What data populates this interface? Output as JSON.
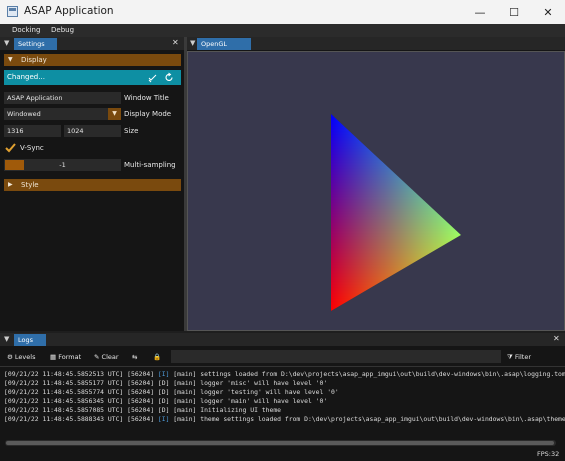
{
  "window": {
    "title": "ASAP Application",
    "minimize_glyph": "—",
    "maximize_glyph": "☐",
    "close_glyph": "✕"
  },
  "menu": {
    "items": [
      "Docking",
      "Debug"
    ]
  },
  "settings": {
    "tab_label": "Settings",
    "close_glyph": "✕",
    "display_header": "Display",
    "changed_label": "Changed...",
    "window_title_value": "ASAP Application",
    "window_title_label": "Window Title",
    "display_mode_value": "Windowed",
    "display_mode_label": "Display Mode",
    "width_value": "1316",
    "height_value": "1024",
    "size_label": "Size",
    "vsync_label": "V-Sync",
    "vsync_checked": true,
    "multisampling_value": "-1",
    "multisampling_label": "Multi-sampling",
    "style_header": "Style"
  },
  "render": {
    "tab_label": "OpenGL Render"
  },
  "logs": {
    "tab_label": "Logs",
    "close_glyph": "✕",
    "toolbar": {
      "levels": "Levels",
      "format": "Format",
      "clear": "Clear",
      "filter": "Filter"
    },
    "lines": [
      {
        "prefix": "[09/21/22 11:48:45.5852513 UTC] [56204] ",
        "level": "[I]",
        "msg": " [main] settings loaded from D:\\dev\\projects\\asap_app_imgui\\out\\build\\dev-windows\\bin\\.asap\\logging.toml"
      },
      {
        "prefix": "[09/21/22 11:48:45.5855177 UTC] [56204] ",
        "level": "[D]",
        "msg": " [main] logger 'misc' will have level '0'"
      },
      {
        "prefix": "[09/21/22 11:48:45.5855774 UTC] [56204] ",
        "level": "[D]",
        "msg": " [main] logger 'testing' will have level '0'"
      },
      {
        "prefix": "[09/21/22 11:48:45.5856345 UTC] [56204] ",
        "level": "[D]",
        "msg": " [main] logger 'main' will have level '0'"
      },
      {
        "prefix": "[09/21/22 11:48:45.5857085 UTC] [56204] ",
        "level": "[D]",
        "msg": " [main] Initializing UI theme"
      },
      {
        "prefix": "[09/21/22 11:48:45.5888343 UTC] [56204] ",
        "level": "[I]",
        "msg": " [main] theme settings loaded from D:\\dev\\projects\\asap_app_imgui\\out\\build\\dev-windows\\bin\\.asap\\theme.tom"
      }
    ],
    "fps": "FPS:32"
  },
  "colors": {
    "accent_tab": "#2f6ea9",
    "header_orange": "#7a4a0e",
    "changed_teal": "#0e8fa3",
    "info_level": "#4e9ad8",
    "viewport_bg": "#38384d"
  }
}
